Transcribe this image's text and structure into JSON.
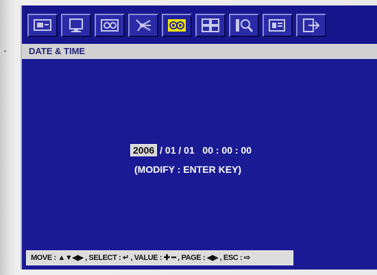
{
  "menu": {
    "tabs": [
      {
        "icon": "monitor-icon",
        "active": false
      },
      {
        "icon": "display-icon",
        "active": false
      },
      {
        "icon": "record-icon",
        "active": false
      },
      {
        "icon": "motion-icon",
        "active": false
      },
      {
        "icon": "system-settings-icon",
        "active": true
      },
      {
        "icon": "layout-icon",
        "active": false
      },
      {
        "icon": "search-icon",
        "active": false
      },
      {
        "icon": "event-icon",
        "active": false
      },
      {
        "icon": "exit-icon",
        "active": false
      }
    ]
  },
  "header": {
    "title": "DATE & TIME"
  },
  "datetime": {
    "year": "2006",
    "rest": "/ 01 / 01   00 : 00 : 00",
    "modify_hint": "(MODIFY : ENTER KEY)"
  },
  "help_bar": {
    "text": "MOVE : ▲▼◀▶ , SELECT : ↵ , VALUE : ✚ ━ , PAGE : ◀▶ , ESC : ⇨"
  },
  "colors": {
    "screen_bg": "#1a1a95",
    "header_bg": "#d2d2d2",
    "active_icon": "#f2e400",
    "highlight": "#d7d7d7"
  }
}
